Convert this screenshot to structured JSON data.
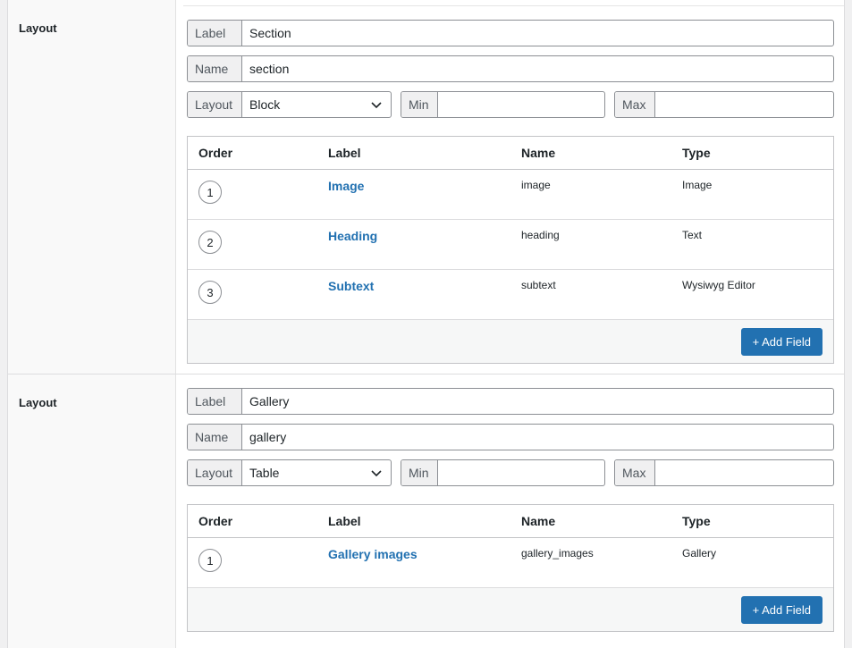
{
  "layouts": [
    {
      "section_label": "Layout",
      "label_prefix": "Label",
      "label_value": "Section",
      "name_prefix": "Name",
      "name_value": "section",
      "layout_prefix": "Layout",
      "layout_value": "Block",
      "min_prefix": "Min",
      "min_value": "",
      "max_prefix": "Max",
      "max_value": "",
      "columns": [
        "Order",
        "Label",
        "Name",
        "Type"
      ],
      "rows": [
        {
          "order": "1",
          "label": "Image",
          "name": "image",
          "type": "Image"
        },
        {
          "order": "2",
          "label": "Heading",
          "name": "heading",
          "type": "Text"
        },
        {
          "order": "3",
          "label": "Subtext",
          "name": "subtext",
          "type": "Wysiwyg Editor"
        }
      ],
      "add_button": "+ Add Field"
    },
    {
      "section_label": "Layout",
      "label_prefix": "Label",
      "label_value": "Gallery",
      "name_prefix": "Name",
      "name_value": "gallery",
      "layout_prefix": "Layout",
      "layout_value": "Table",
      "min_prefix": "Min",
      "min_value": "",
      "max_prefix": "Max",
      "max_value": "",
      "columns": [
        "Order",
        "Label",
        "Name",
        "Type"
      ],
      "rows": [
        {
          "order": "1",
          "label": "Gallery images",
          "name": "gallery_images",
          "type": "Gallery"
        }
      ],
      "add_button": "+ Add Field"
    }
  ]
}
